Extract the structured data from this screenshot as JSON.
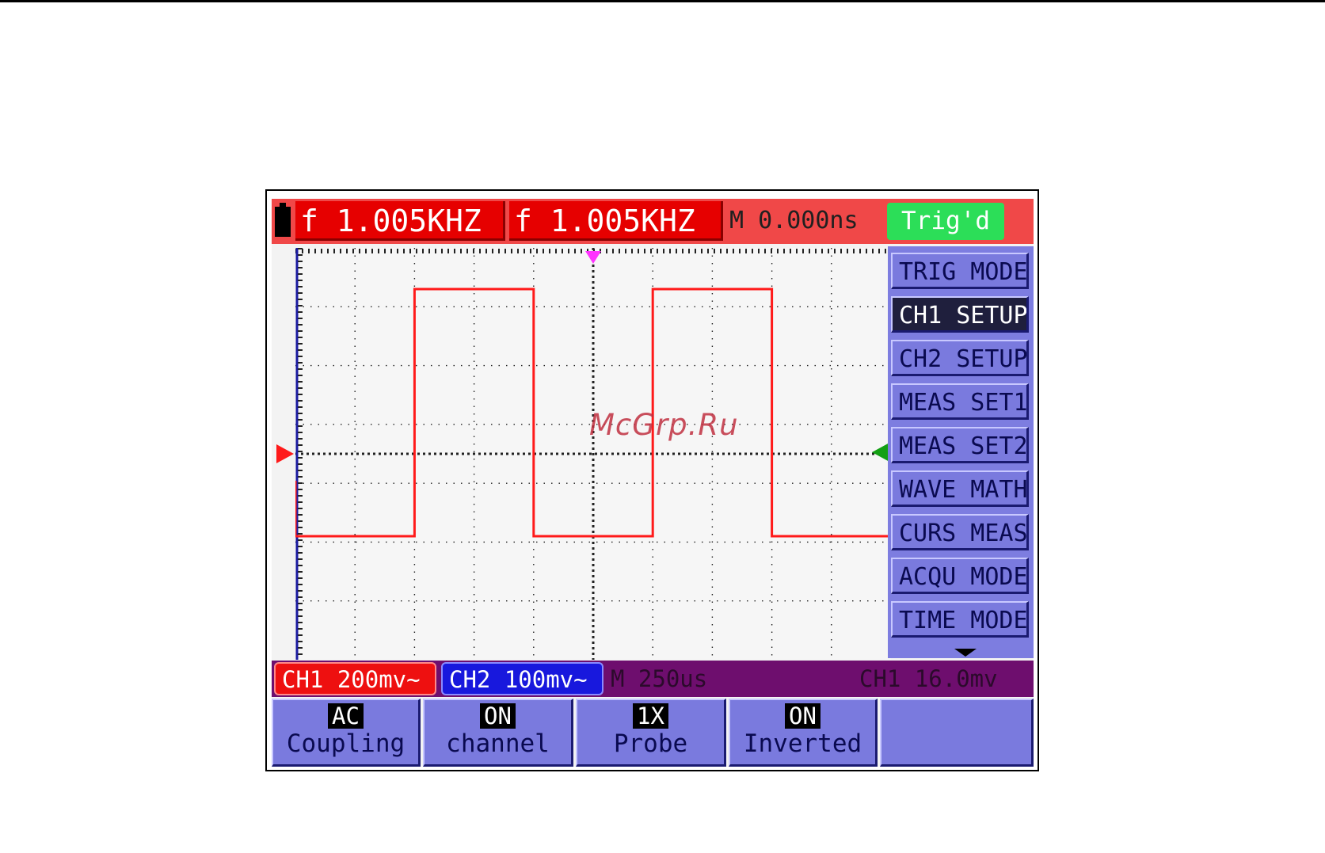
{
  "status_bar": {
    "ch1_frequency": "f 1.005KHZ",
    "ch2_frequency": "f 1.005KHZ",
    "trigger_delay": "M 0.000ns",
    "trigger_status": "Trig'd"
  },
  "menu": {
    "items": [
      {
        "label": "TRIG MODE",
        "active": false
      },
      {
        "label": "CH1 SETUP",
        "active": true
      },
      {
        "label": "CH2 SETUP",
        "active": false
      },
      {
        "label": "MEAS SET1",
        "active": false
      },
      {
        "label": "MEAS SET2",
        "active": false
      },
      {
        "label": "WAVE MATH",
        "active": false
      },
      {
        "label": "CURS MEAS",
        "active": false
      },
      {
        "label": "ACQU MODE",
        "active": false
      },
      {
        "label": "TIME MODE",
        "active": false
      }
    ]
  },
  "info_bar": {
    "ch1_scale": "CH1 200mv~",
    "ch2_scale": "CH2 100mv~",
    "timebase": "M 250us",
    "trigger_level": "CH1 16.0mv"
  },
  "softkeys": [
    {
      "value": "AC",
      "label": "Coupling"
    },
    {
      "value": "ON",
      "label": "channel"
    },
    {
      "value": "1X",
      "label": "Probe"
    },
    {
      "value": "ON",
      "label": "Inverted"
    },
    {
      "value": "",
      "label": ""
    }
  ],
  "waveform": {
    "channel": "CH1",
    "color": "#ff1a1a",
    "shape": "square",
    "high_div": 2.8,
    "low_div": -1.4,
    "rising_edges_div": [
      2.0,
      6.0
    ],
    "falling_edges_div": [
      4.0,
      8.0
    ],
    "starts_low": true
  },
  "grid": {
    "h_divisions": 10,
    "v_divisions": 7
  },
  "colors": {
    "status_red": "#e60000",
    "trig_green": "#2cde58",
    "menu_blue": "#7a7ade",
    "info_purple": "#6e0e6e",
    "ch2_blue": "#1818dd",
    "trigger_marker": "#ff33ff",
    "ch2_marker": "#14a014"
  },
  "watermark": "McGrp.Ru"
}
